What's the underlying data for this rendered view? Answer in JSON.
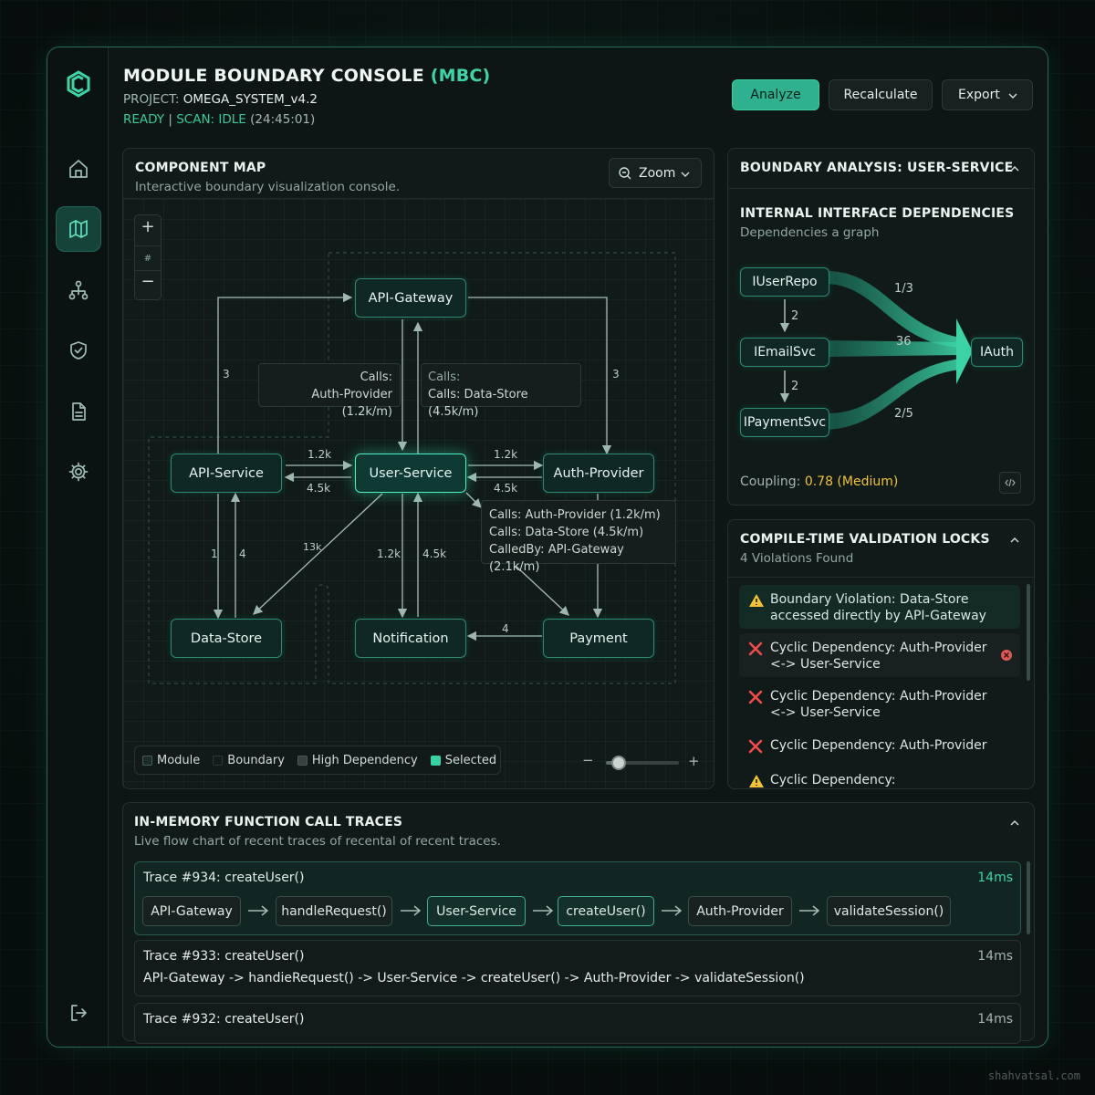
{
  "header": {
    "title": "MODULE BOUNDARY CONSOLE",
    "title_accent": "(MBC)",
    "project_label": "PROJECT:",
    "project_value": "OMEGA_SYSTEM_v4.2",
    "status_ready": "READY",
    "status_sep": "|",
    "status_scan": "SCAN: IDLE",
    "status_time": "(24:45:01)",
    "buttons": {
      "analyze": "Analyze",
      "recalculate": "Recalculate",
      "export": "Export"
    }
  },
  "sidebar": {
    "items": [
      {
        "icon": "home-icon",
        "active": false
      },
      {
        "icon": "map-icon",
        "active": true
      },
      {
        "icon": "hierarchy-icon",
        "active": false
      },
      {
        "icon": "shield-icon",
        "active": false
      },
      {
        "icon": "document-icon",
        "active": false
      },
      {
        "icon": "settings-icon",
        "active": false
      }
    ],
    "logout_icon": "logout-icon"
  },
  "component_map": {
    "title": "COMPONENT MAP",
    "subtitle": "Interactive boundary visualization console.",
    "zoom_label": "Zoom",
    "zoom_controls": {
      "plus": "+",
      "hash": "#",
      "minus": "−"
    },
    "nodes": {
      "api_gateway": "API-Gateway",
      "api_service": "API-Service",
      "user_service": "User-Service",
      "auth_provider": "Auth-Provider",
      "data_store": "Data-Store",
      "notification": "Notification",
      "payment": "Payment"
    },
    "edge_labels": {
      "gw_left": "3",
      "gw_right": "3",
      "api_user_top": "1.2k",
      "api_user_bottom": "4.5k",
      "user_auth_top": "1.2k",
      "user_auth_bottom": "4.5k",
      "api_data_left": "1",
      "api_data_right": "4",
      "user_data": "13k",
      "user_notif_left": "1.2k",
      "user_notif_right": "4.5k",
      "pay_notif": "4"
    },
    "tooltips": {
      "left_line1": "Calls:",
      "left_line2": "Auth-Provider (1.2k/m)",
      "mid_line1": "Calls:",
      "mid_line2": "Calls: Data-Store (4.5k/m)",
      "detail_line1": "Calls: Auth-Provider (1.2k/m)",
      "detail_line2": "Calls: Data-Store (4.5k/m)",
      "detail_line3": "CalledBy: API-Gateway (2.1k/m)"
    },
    "legend": {
      "module": "Module",
      "boundary": "Boundary",
      "high_dependency": "High Dependency",
      "selected": "Selected"
    },
    "slider": {
      "minus": "−",
      "plus": "+",
      "level": 0.1
    }
  },
  "boundary_analysis": {
    "title": "BOUNDARY ANALYSIS: USER-SERVICE",
    "section_title": "INTERNAL INTERFACE DEPENDENCIES",
    "section_subtitle": "Dependencies a graph",
    "nodes": {
      "iuserrepo": "IUserRepo",
      "iemailsvc": "IEmailSvc",
      "ipaymentsvc": "IPaymentSvc",
      "iauth": "IAuth"
    },
    "labels": {
      "top_ratio": "1/3",
      "user_email": "2",
      "email_payment": "2",
      "mid_count": "36",
      "bottom_ratio": "2/5"
    },
    "coupling_label": "Coupling:",
    "coupling_value": "0.78 (Medium)"
  },
  "validation_locks": {
    "title": "COMPILE-TIME VALIDATION LOCKS",
    "subtitle": "4 Violations Found",
    "items": [
      {
        "type": "warning",
        "line1": "Boundary Violation: Data-Store",
        "line2": "accessed directly by API-Gateway"
      },
      {
        "type": "error",
        "line1": "Cyclic Dependency: Auth-Provider",
        "line2": "<-> User-Service"
      },
      {
        "type": "error",
        "line1": "Cyclic Dependency: Auth-Provider",
        "line2": "<-> User-Service"
      },
      {
        "type": "error",
        "line1": "Cyclic Dependency: Auth-Provider",
        "line2": ""
      },
      {
        "type": "warning",
        "line1": "Cyclic Dependency:",
        "line2": ""
      }
    ]
  },
  "call_traces": {
    "title": "IN-MEMORY FUNCTION CALL TRACES",
    "subtitle": "Live flow chart of recent traces of recental of recent traces.",
    "traces": [
      {
        "name": "Trace #934: createUser()",
        "duration": "14ms",
        "chain": [
          "API-Gateway",
          "handleRequest()",
          "User-Service",
          "createUser()",
          "Auth-Provider",
          "validateSession()"
        ]
      },
      {
        "name": "Trace #933: createUser()",
        "duration": "14ms",
        "path": "API-Gateway -> handieRequest() -> User-Service -> createUser() -> Auth-Provider -> validateSession()"
      },
      {
        "name": "Trace #932: createUser()",
        "duration": "14ms"
      }
    ]
  },
  "watermark": "shahvatsal.com",
  "colors": {
    "accent": "#3ed4a8",
    "warning": "#f2c23a",
    "error": "#ef4b4b",
    "panel": "#101a18"
  }
}
